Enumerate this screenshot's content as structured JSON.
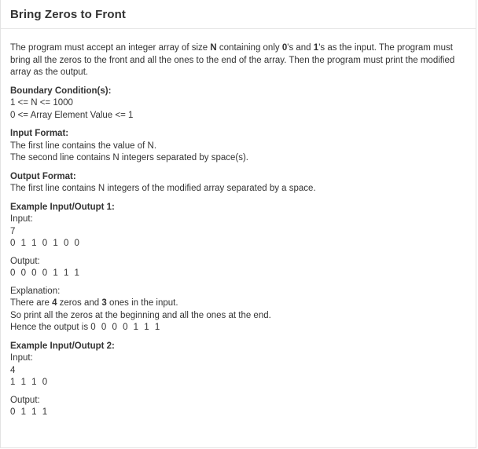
{
  "title": "Bring Zeros to Front",
  "description": {
    "p1": "The program must accept an integer array of size ",
    "b1": "N",
    "p2": " containing only ",
    "b2": "0",
    "p3": "'s and ",
    "b3": "1",
    "p4": "'s as the input. The program must bring all the zeros to the front and all the ones to the end of the array. Then the program must print the modified array as the output."
  },
  "boundary": {
    "label": "Boundary Condition(s):",
    "lines": [
      "1 <= N <= 1000",
      "0 <= Array Element Value <= 1"
    ]
  },
  "input_format": {
    "label": "Input Format:",
    "lines": [
      "The first line contains the value of N.",
      "The second line contains N integers separated by space(s)."
    ]
  },
  "output_format": {
    "label": "Output Format:",
    "lines": [
      "The first line contains N integers of the modified array separated by a space."
    ]
  },
  "example1": {
    "label": "Example Input/Outupt 1:",
    "input_label": "Input:",
    "input_lines": [
      "7",
      "0 1 1 0 1 0 0"
    ],
    "output_label": "Output:",
    "output_lines": [
      "0 0 0 0 1 1 1"
    ],
    "explanation_label": "Explanation:",
    "exp_line1_a": "There are ",
    "exp_line1_b": "4",
    "exp_line1_c": " zeros and ",
    "exp_line1_d": "3",
    "exp_line1_e": " ones in the input.",
    "exp_line2": "So print all the zeros at the beginning and all the ones at the end.",
    "exp_line3_a": "Hence the output is ",
    "exp_line3_b": "0 0 0 0 1 1 1"
  },
  "example2": {
    "label": "Example Input/Outupt 2:",
    "input_label": "Input:",
    "input_lines": [
      "4",
      "1 1 1 0"
    ],
    "output_label": "Output:",
    "output_lines": [
      "0 1 1 1"
    ]
  }
}
